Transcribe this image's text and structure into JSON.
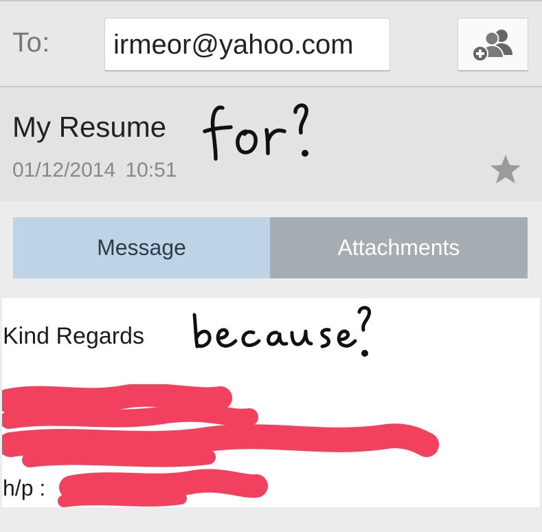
{
  "compose": {
    "to_label": "To:",
    "to_value": "irmeor@yahoo.com",
    "add_contact_icon": "add-contacts-icon"
  },
  "header": {
    "subject": "My Resume",
    "datetime": "01/12/2014 10:51",
    "star_icon": "star-icon"
  },
  "annotations": {
    "near_subject": "for?",
    "near_signoff": "because?"
  },
  "tabs": [
    {
      "label": "Message",
      "active": true
    },
    {
      "label": "Attachments",
      "active": false
    }
  ],
  "body": {
    "signoff": "Kind Regards",
    "phone_label": "h/p :"
  },
  "colors": {
    "tab_active": "#bcd4e6",
    "tab_inactive": "#a5adb3",
    "redaction": "#f1415e",
    "background": "#ececec"
  }
}
